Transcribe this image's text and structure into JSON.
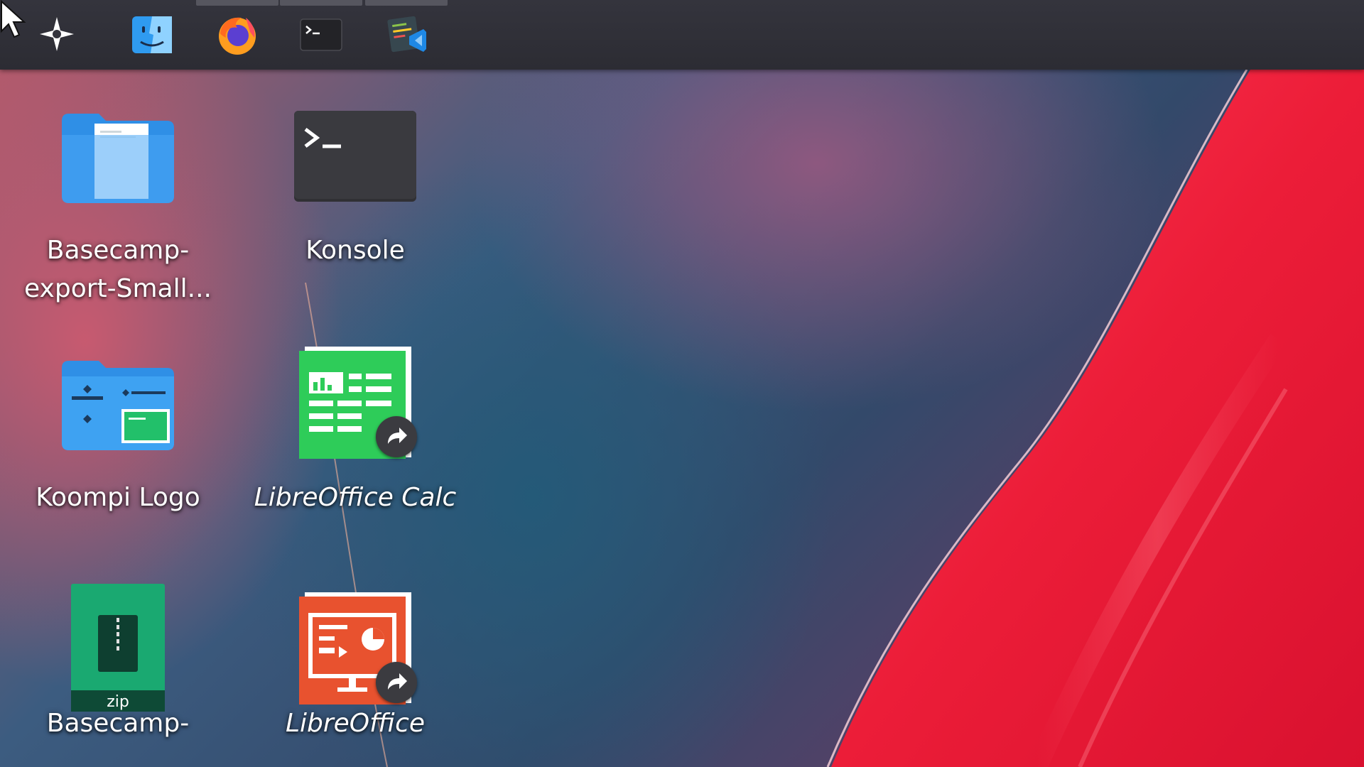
{
  "taskbar": {
    "launcher": {
      "icon": "kde-launcher-icon"
    },
    "tasks": [
      {
        "name": "file-manager",
        "icon": "finder-face-icon",
        "active": false
      },
      {
        "name": "firefox",
        "icon": "firefox-icon",
        "active": true
      },
      {
        "name": "konsole",
        "icon": "terminal-icon",
        "active": true
      },
      {
        "name": "code-editor",
        "icon": "vscode-icon",
        "active": true
      }
    ]
  },
  "desktop": {
    "icons": [
      {
        "label": "Basecamp-\nexport-Small...",
        "icon": "folder-document-icon",
        "italic": false
      },
      {
        "label": "Konsole",
        "icon": "terminal-icon",
        "italic": false
      },
      {
        "label": "Koompi Logo",
        "icon": "folder-images-icon",
        "italic": false
      },
      {
        "label": "LibreOffice Calc",
        "icon": "spreadsheet-icon",
        "italic": true
      },
      {
        "label": "Basecamp-",
        "icon": "zip-archive-icon",
        "italic": false,
        "badge_text": "zip"
      },
      {
        "label": "LibreOffice",
        "icon": "presentation-icon",
        "italic": true
      }
    ]
  },
  "colors": {
    "panel": "#2f2f36",
    "wallpaper_red": "#e8213b",
    "folder_blue": "#3da3f0",
    "calc_green": "#2ecc59",
    "impress_orange": "#e8522f",
    "zip_green": "#1aa971"
  }
}
